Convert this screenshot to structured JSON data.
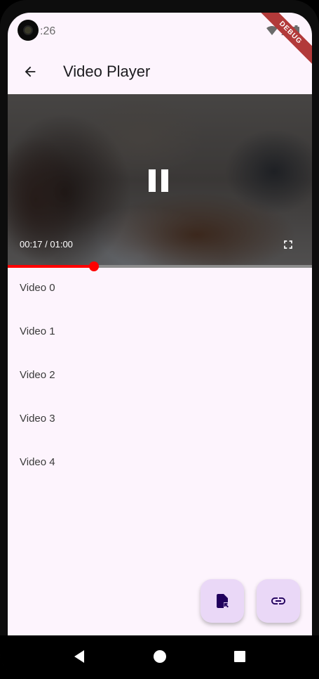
{
  "status_bar": {
    "time": ":26",
    "debug_label": "DEBUG"
  },
  "app_bar": {
    "title": "Video Player",
    "back_icon": "arrow-left-icon"
  },
  "player": {
    "time_display": "00:17 / 01:00",
    "progress": 0.283,
    "state": "playing",
    "accent_color": "#ff0000"
  },
  "videos": [
    "Video 0",
    "Video 1",
    "Video 2",
    "Video 3",
    "Video 4"
  ],
  "fabs": [
    {
      "icon": "file-open-icon"
    },
    {
      "icon": "link-icon"
    }
  ],
  "colors": {
    "background": "#fdf4fd",
    "fab": "#ead8f7",
    "fab_icon": "#21005d"
  }
}
